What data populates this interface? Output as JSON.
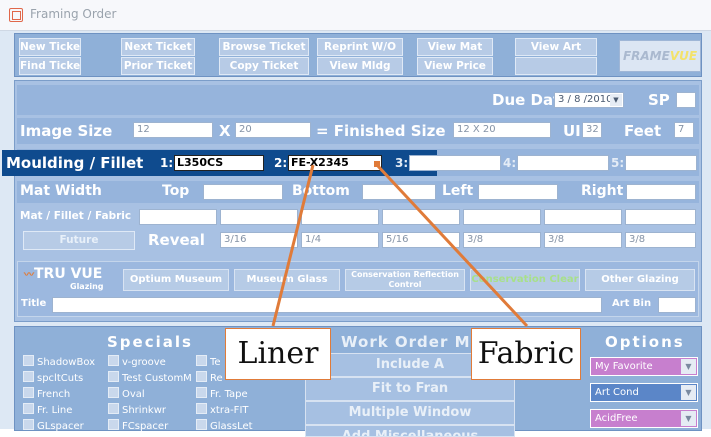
{
  "window": {
    "title": "Framing Order"
  },
  "toolbar": {
    "row1": [
      "New Ticket",
      "Next Ticket",
      "Browse Ticket",
      "Reprint W/O",
      "View Mat",
      "View Art"
    ],
    "row2": [
      "Find Ticket",
      "Prior Ticket",
      "Copy Ticket",
      "View Mldg",
      "View Price"
    ],
    "brand_main": "FRAME",
    "brand_accent": "VUE"
  },
  "due": {
    "label": "Due Date",
    "value": "3 / 8 /2010",
    "sp_label": "SP"
  },
  "size": {
    "image_label": "Image Size",
    "width": "12",
    "x": "X",
    "height": "20",
    "finished_label": "= Finished Size",
    "finished": "12 X 20",
    "ui_label": "UI",
    "ui": "32",
    "feet_label": "Feet",
    "feet": "7"
  },
  "moulding": {
    "label": "Moulding / Fillet",
    "slots": [
      {
        "num": "1:",
        "value": "L350CS"
      },
      {
        "num": "2:",
        "value": "FE-X2345"
      },
      {
        "num": "3:",
        "value": ""
      },
      {
        "num": "4:",
        "value": ""
      },
      {
        "num": "5:",
        "value": ""
      }
    ]
  },
  "mat": {
    "width_label": "Mat Width",
    "top": "Top",
    "bottom": "Bottom",
    "left": "Left",
    "right": "Right",
    "fabric_label": "Mat / Fillet / Fabric"
  },
  "reveal": {
    "future": "Future",
    "label": "Reveal",
    "values": [
      "3/16",
      "1/4",
      "5/16",
      "3/8",
      "3/8",
      "3/8"
    ]
  },
  "glazing": {
    "logo": "TRU VUE",
    "logo_sub": "Glazing",
    "buttons": [
      "Optium Museum",
      "Museum Glass",
      "Conservation Reflection Control",
      "Conservation Clear",
      "Other Glazing"
    ],
    "title_label": "Title",
    "artbin_label": "Art Bin"
  },
  "specials": {
    "heading": "Specials",
    "col1": [
      "ShadowBox",
      "spcltCuts",
      "French",
      "Fr. Line",
      "GLspacer"
    ],
    "col2": [
      "v-groove",
      "Test CustomM",
      "Oval",
      "Shrinkwr",
      "FCspacer"
    ],
    "col3": [
      "Te",
      "Re",
      "Fr. Tape",
      "xtra-FIT",
      "GlassLet"
    ]
  },
  "workorder": {
    "heading": "Work Order M",
    "buttons": [
      "Include A",
      "Fit to Fran",
      "Multiple Window",
      "Add Miscellaneous"
    ]
  },
  "options": {
    "heading": "Options",
    "items": [
      {
        "label": "My Favorite",
        "color": "#c77fce"
      },
      {
        "label": "Art Cond",
        "color": "#5b86c8"
      },
      {
        "label": "AcidFree",
        "color": "#c77fce"
      }
    ]
  },
  "callouts": {
    "liner": "Liner",
    "fabric": "Fabric"
  },
  "colors": {
    "accent": "#e07b39",
    "moulding_bar": "#0f4b8e"
  }
}
